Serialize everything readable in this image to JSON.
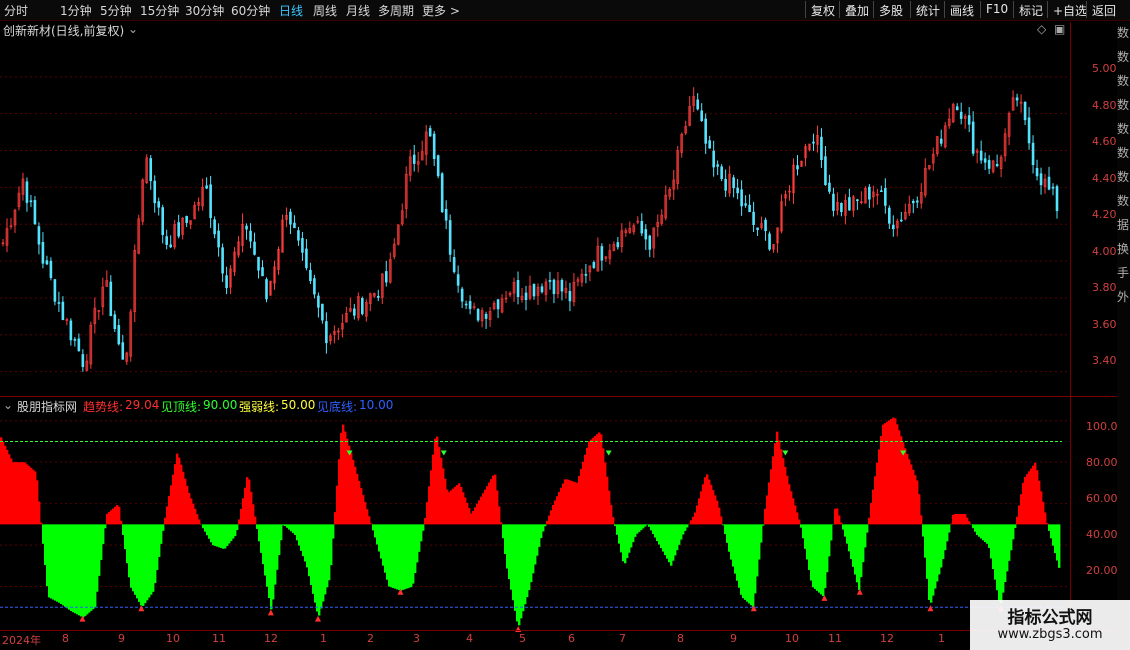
{
  "toolbar": {
    "timeframes": [
      "分时",
      "1分钟",
      "5分钟",
      "15分钟",
      "30分钟",
      "60分钟",
      "日线",
      "周线",
      "月线",
      "多周期",
      "更多 >"
    ],
    "active_timeframe": "日线",
    "right_buttons": [
      "复权",
      "叠加",
      "多股",
      "统计",
      "画线",
      "F10",
      "标记",
      "+自选",
      "返回"
    ]
  },
  "price_panel": {
    "title": "创新新材(日线,前复权)",
    "y_ticks": [
      "5.00",
      "4.80",
      "4.60",
      "4.40",
      "4.20",
      "4.00",
      "3.80",
      "3.60",
      "3.40"
    ]
  },
  "indicator_panel": {
    "name": "股朋指标网",
    "lines": [
      {
        "label": "趋势线:",
        "value": "29.04",
        "color": "#ff3030"
      },
      {
        "label": "见顶线:",
        "value": "90.00",
        "color": "#30ff30"
      },
      {
        "label": "强弱线:",
        "value": "50.00",
        "color": "#ffff40"
      },
      {
        "label": "见底线:",
        "value": "10.00",
        "color": "#3060ff"
      }
    ],
    "y_ticks": [
      "100.0",
      "80.00",
      "60.00",
      "40.00",
      "20.00"
    ]
  },
  "x_axis": {
    "labels": [
      "2024年",
      "8",
      "9",
      "10",
      "11",
      "12",
      "1",
      "2",
      "3",
      "4",
      "5",
      "6",
      "7",
      "8",
      "9",
      "10",
      "11",
      "12",
      "1"
    ]
  },
  "right_column_text": "数数数数数数数数据换手外",
  "watermark": {
    "title": "指标公式网",
    "url": "www.zbgs3.com"
  },
  "chart_data": [
    {
      "type": "candlestick",
      "title": "创新新材(日线,前复权)",
      "ylim": [
        3.3,
        5.2
      ],
      "y_ticks": [
        5.0,
        4.8,
        4.6,
        4.4,
        4.2,
        4.0,
        3.8,
        3.6,
        3.4
      ],
      "x_labels": [
        "2024年",
        "8",
        "9",
        "10",
        "11",
        "12",
        "1",
        "2",
        "3",
        "4",
        "5",
        "6",
        "7",
        "8",
        "9",
        "10",
        "11",
        "12",
        "1"
      ],
      "close_trajectory": [
        4.1,
        4.45,
        4.0,
        3.7,
        3.45,
        3.9,
        3.4,
        4.6,
        4.1,
        4.2,
        4.4,
        3.9,
        4.2,
        3.8,
        4.3,
        3.9,
        3.6,
        3.7,
        3.8,
        3.9,
        4.5,
        4.7,
        4.1,
        3.7,
        3.75,
        3.85,
        3.85,
        3.9,
        3.8,
        4.0,
        4.1,
        4.2,
        4.1,
        4.4,
        4.9,
        4.5,
        4.4,
        4.2,
        4.1,
        4.5,
        4.7,
        4.3,
        4.3,
        4.4,
        4.2,
        4.35,
        4.6,
        4.9,
        4.6,
        4.5,
        4.9,
        4.5,
        4.3
      ]
    },
    {
      "type": "area",
      "title": "股朋指标网",
      "ylim": [
        0,
        110
      ],
      "reference_lines": {
        "见顶线": 90,
        "强弱线": 50,
        "见底线": 10
      },
      "last_value": 29.04,
      "series": [
        {
          "name": "趋势线",
          "values": [
            92,
            80,
            80,
            75,
            15,
            12,
            8,
            5,
            10,
            55,
            60,
            20,
            10,
            18,
            55,
            85,
            65,
            50,
            40,
            38,
            45,
            75,
            40,
            8,
            50,
            45,
            30,
            5,
            25,
            100,
            80,
            60,
            40,
            20,
            18,
            20,
            50,
            95,
            65,
            70,
            55,
            65,
            75,
            30,
            0,
            20,
            45,
            60,
            72,
            70,
            90,
            95,
            55,
            30,
            45,
            50,
            40,
            30,
            45,
            55,
            75,
            60,
            35,
            15,
            10,
            58,
            95,
            70,
            50,
            20,
            15,
            60,
            40,
            18,
            60,
            98,
            102,
            85,
            70,
            10,
            30,
            55,
            55,
            45,
            40,
            10,
            40,
            72,
            80,
            50,
            29
          ]
        }
      ]
    }
  ]
}
